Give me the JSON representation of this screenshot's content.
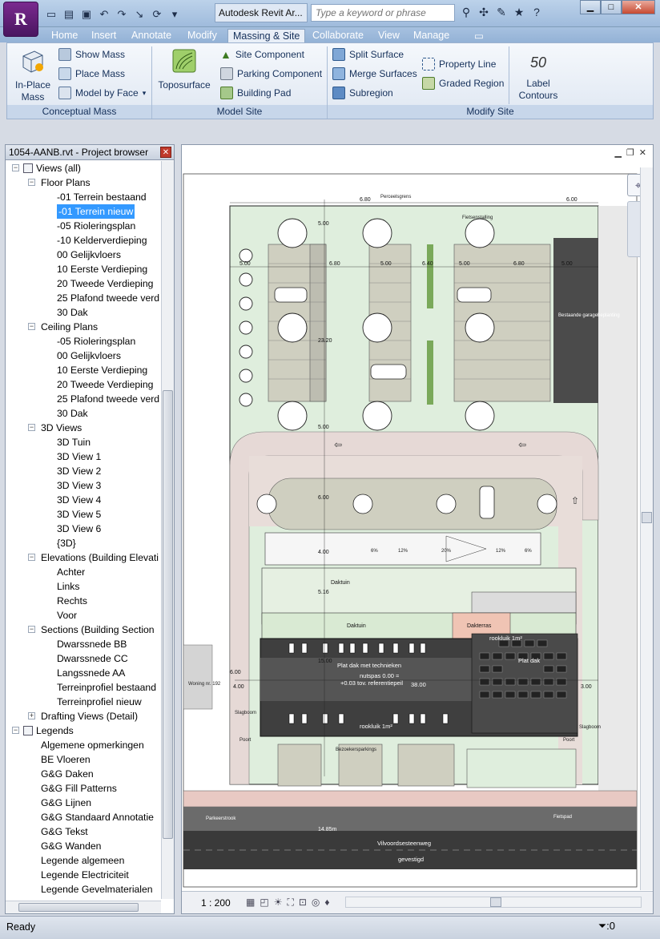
{
  "app": {
    "title": "Autodesk Revit Ar...",
    "logo_letter": "R",
    "search_placeholder": "Type a keyword or phrase"
  },
  "ribbon": {
    "tabs": [
      "Home",
      "Insert",
      "Annotate",
      "Modify",
      "Massing & Site",
      "Collaborate",
      "View",
      "Manage"
    ],
    "active_tab": "Massing & Site",
    "conceptual_mass": {
      "title": "Conceptual Mass",
      "in_place_mass": "In-Place Mass",
      "in_place_line1": "In-Place",
      "in_place_line2": "Mass",
      "show_mass": "Show Mass",
      "place_mass": "Place Mass",
      "model_by_face": "Model by Face"
    },
    "model_site": {
      "title": "Model Site",
      "toposurface": "Toposurface",
      "site_component": "Site Component",
      "parking_component": "Parking Component",
      "building_pad": "Building Pad"
    },
    "modify_site": {
      "title": "Modify Site",
      "split_surface": "Split Surface",
      "merge_surfaces": "Merge Surfaces",
      "subregion": "Subregion",
      "property_line": "Property Line",
      "graded_region": "Graded Region",
      "label_contours_line1": "Label",
      "label_contours_line2": "Contours",
      "label_contours_glyph": "50"
    }
  },
  "project_browser": {
    "title": "1054-AANB.rvt - Project browser",
    "rows": [
      {
        "label": "Views (all)",
        "level": 0,
        "expander": "−",
        "icon": true
      },
      {
        "label": "Floor Plans",
        "level": 1,
        "expander": "−"
      },
      {
        "label": "-01 Terrein bestaand",
        "level": 2
      },
      {
        "label": "-01 Terrein nieuw",
        "level": 2,
        "selected": true
      },
      {
        "label": "-05 Rioleringsplan",
        "level": 2
      },
      {
        "label": "-10 Kelderverdieping",
        "level": 2
      },
      {
        "label": "00 Gelijkvloers",
        "level": 2
      },
      {
        "label": "10 Eerste Verdieping",
        "level": 2
      },
      {
        "label": "20 Tweede Verdieping",
        "level": 2
      },
      {
        "label": "25 Plafond tweede verd",
        "level": 2
      },
      {
        "label": "30 Dak",
        "level": 2
      },
      {
        "label": "Ceiling Plans",
        "level": 1,
        "expander": "−"
      },
      {
        "label": "-05 Rioleringsplan",
        "level": 2
      },
      {
        "label": "00 Gelijkvloers",
        "level": 2
      },
      {
        "label": "10 Eerste Verdieping",
        "level": 2
      },
      {
        "label": "20 Tweede Verdieping",
        "level": 2
      },
      {
        "label": "25 Plafond tweede verd",
        "level": 2
      },
      {
        "label": "30 Dak",
        "level": 2
      },
      {
        "label": "3D Views",
        "level": 1,
        "expander": "−"
      },
      {
        "label": "3D Tuin",
        "level": 2
      },
      {
        "label": "3D View 1",
        "level": 2
      },
      {
        "label": "3D View 2",
        "level": 2
      },
      {
        "label": "3D View 3",
        "level": 2
      },
      {
        "label": "3D View 4",
        "level": 2
      },
      {
        "label": "3D View 5",
        "level": 2
      },
      {
        "label": "3D View 6",
        "level": 2
      },
      {
        "label": "{3D}",
        "level": 2
      },
      {
        "label": "Elevations (Building Elevati",
        "level": 1,
        "expander": "−"
      },
      {
        "label": "Achter",
        "level": 2
      },
      {
        "label": "Links",
        "level": 2
      },
      {
        "label": "Rechts",
        "level": 2
      },
      {
        "label": "Voor",
        "level": 2
      },
      {
        "label": "Sections (Building Section",
        "level": 1,
        "expander": "−"
      },
      {
        "label": "Dwarssnede BB",
        "level": 2
      },
      {
        "label": "Dwarssnede CC",
        "level": 2
      },
      {
        "label": "Langssnede AA",
        "level": 2
      },
      {
        "label": "Terreinprofiel bestaand",
        "level": 2
      },
      {
        "label": "Terreinprofiel nieuw",
        "level": 2
      },
      {
        "label": "Drafting Views (Detail)",
        "level": 1,
        "expander": "+"
      },
      {
        "label": "Legends",
        "level": 0,
        "expander": "−",
        "icon": true
      },
      {
        "label": "Algemene opmerkingen",
        "level": 1
      },
      {
        "label": "BE Vloeren",
        "level": 1
      },
      {
        "label": "G&G Daken",
        "level": 1
      },
      {
        "label": "G&G Fill Patterns",
        "level": 1
      },
      {
        "label": "G&G Lijnen",
        "level": 1
      },
      {
        "label": "G&G Standaard Annotatie",
        "level": 1
      },
      {
        "label": "G&G Tekst",
        "level": 1
      },
      {
        "label": "G&G Wanden",
        "level": 1
      },
      {
        "label": "Legende algemeen",
        "level": 1
      },
      {
        "label": "Legende Electriciteit",
        "level": 1
      },
      {
        "label": "Legende Gevelmaterialen",
        "level": 1
      }
    ]
  },
  "view": {
    "scale": "1 : 200",
    "plan_labels": {
      "perceelsgrens": "Perceelsgrens",
      "street": "Vilvoordsesteenweg",
      "fietspad": "Fietspad",
      "parkeerstrook": "Parkeerstrook",
      "plat_dak": "Plat dak met technieken",
      "nutspas": "nutspas 0.00 =",
      "peil": "+0.03 tov. referentiepeil",
      "dim_38": "38.00",
      "dakterras": "Dakterras",
      "daktuin_1": "Daktuin",
      "daktuin_2": "Daktuin",
      "rooklut_1": "rookluik 1m²",
      "rooklut_2": "rookluik 1m²",
      "plat_dak_small": "Plat dak",
      "fietsenstalling": "Fietsenstalling",
      "bestaande_garage": "Bestaande garagebeplanting",
      "woning": "Woning nr. 192",
      "slagboom_1": "Slagboom",
      "slagboom_2": "Slagboom",
      "poort_1": "Poort",
      "poort_2": "Poort",
      "bezoekersparking": "Bezoekersparkings",
      "gevestemd": "gevestigd"
    },
    "dims": [
      "6.80",
      "6.00",
      "5.00",
      "6.80",
      "5.00",
      "6.40",
      "5.00",
      "6.80",
      "5.00",
      "23.20",
      "4.00",
      "5.16",
      "15.00",
      "4.00",
      "3.00",
      "6.00",
      "5.00",
      "5.00",
      "6.00",
      "14.85m"
    ],
    "slopes": [
      "6%",
      "12%",
      "20%",
      "12%",
      "6%"
    ]
  },
  "status": {
    "text": "Ready",
    "filter_count": ":0"
  }
}
